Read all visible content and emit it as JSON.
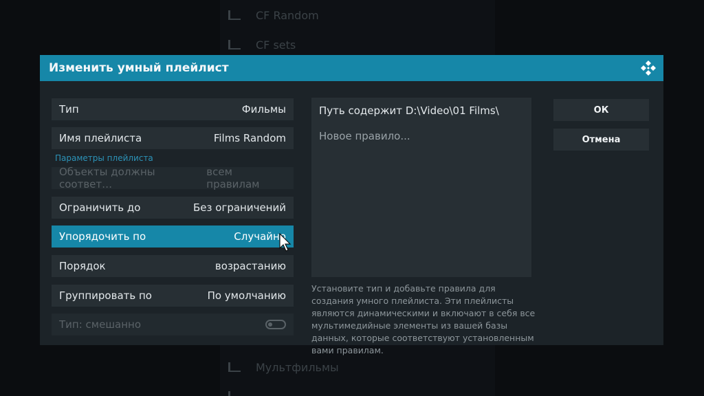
{
  "background": {
    "items": [
      "CF Random",
      "CF sets",
      "Мультфильмы",
      ""
    ]
  },
  "dialog": {
    "title": "Изменить умный плейлист",
    "settings": [
      {
        "label": "Тип",
        "value": "Фильмы",
        "state": "normal"
      },
      {
        "label": "Имя плейлиста",
        "value": "Films Random",
        "state": "normal"
      },
      {
        "label": "Объекты должны соответ…",
        "value": "всем правилам",
        "state": "disabled"
      },
      {
        "label": "Ограничить до",
        "value": "Без ограничений",
        "state": "normal"
      },
      {
        "label": "Упорядочить по",
        "value": "Случайно",
        "state": "focused"
      },
      {
        "label": "Порядок",
        "value": "возрастанию",
        "state": "normal"
      },
      {
        "label": "Группировать по",
        "value": "По умолчанию",
        "state": "normal"
      },
      {
        "label": "Тип: смешанно",
        "value": "",
        "state": "disabled"
      }
    ],
    "section_label": "Параметры плейлиста",
    "rules": [
      "Путь содержит D:\\Video\\01 Films\\",
      "Новое правило..."
    ],
    "help_text": "Установите тип и добавьте правила для создания умного плейлиста. Эти плейлисты являются динамическими и включают в себя все мультимедийные элементы из вашей базы данных, которые соответствуют установленным вами правилам.",
    "buttons": {
      "ok": "ОК",
      "cancel": "Отмена"
    }
  },
  "colors": {
    "accent": "#1687a8",
    "panel": "#1c2328",
    "row": "#272f34"
  }
}
